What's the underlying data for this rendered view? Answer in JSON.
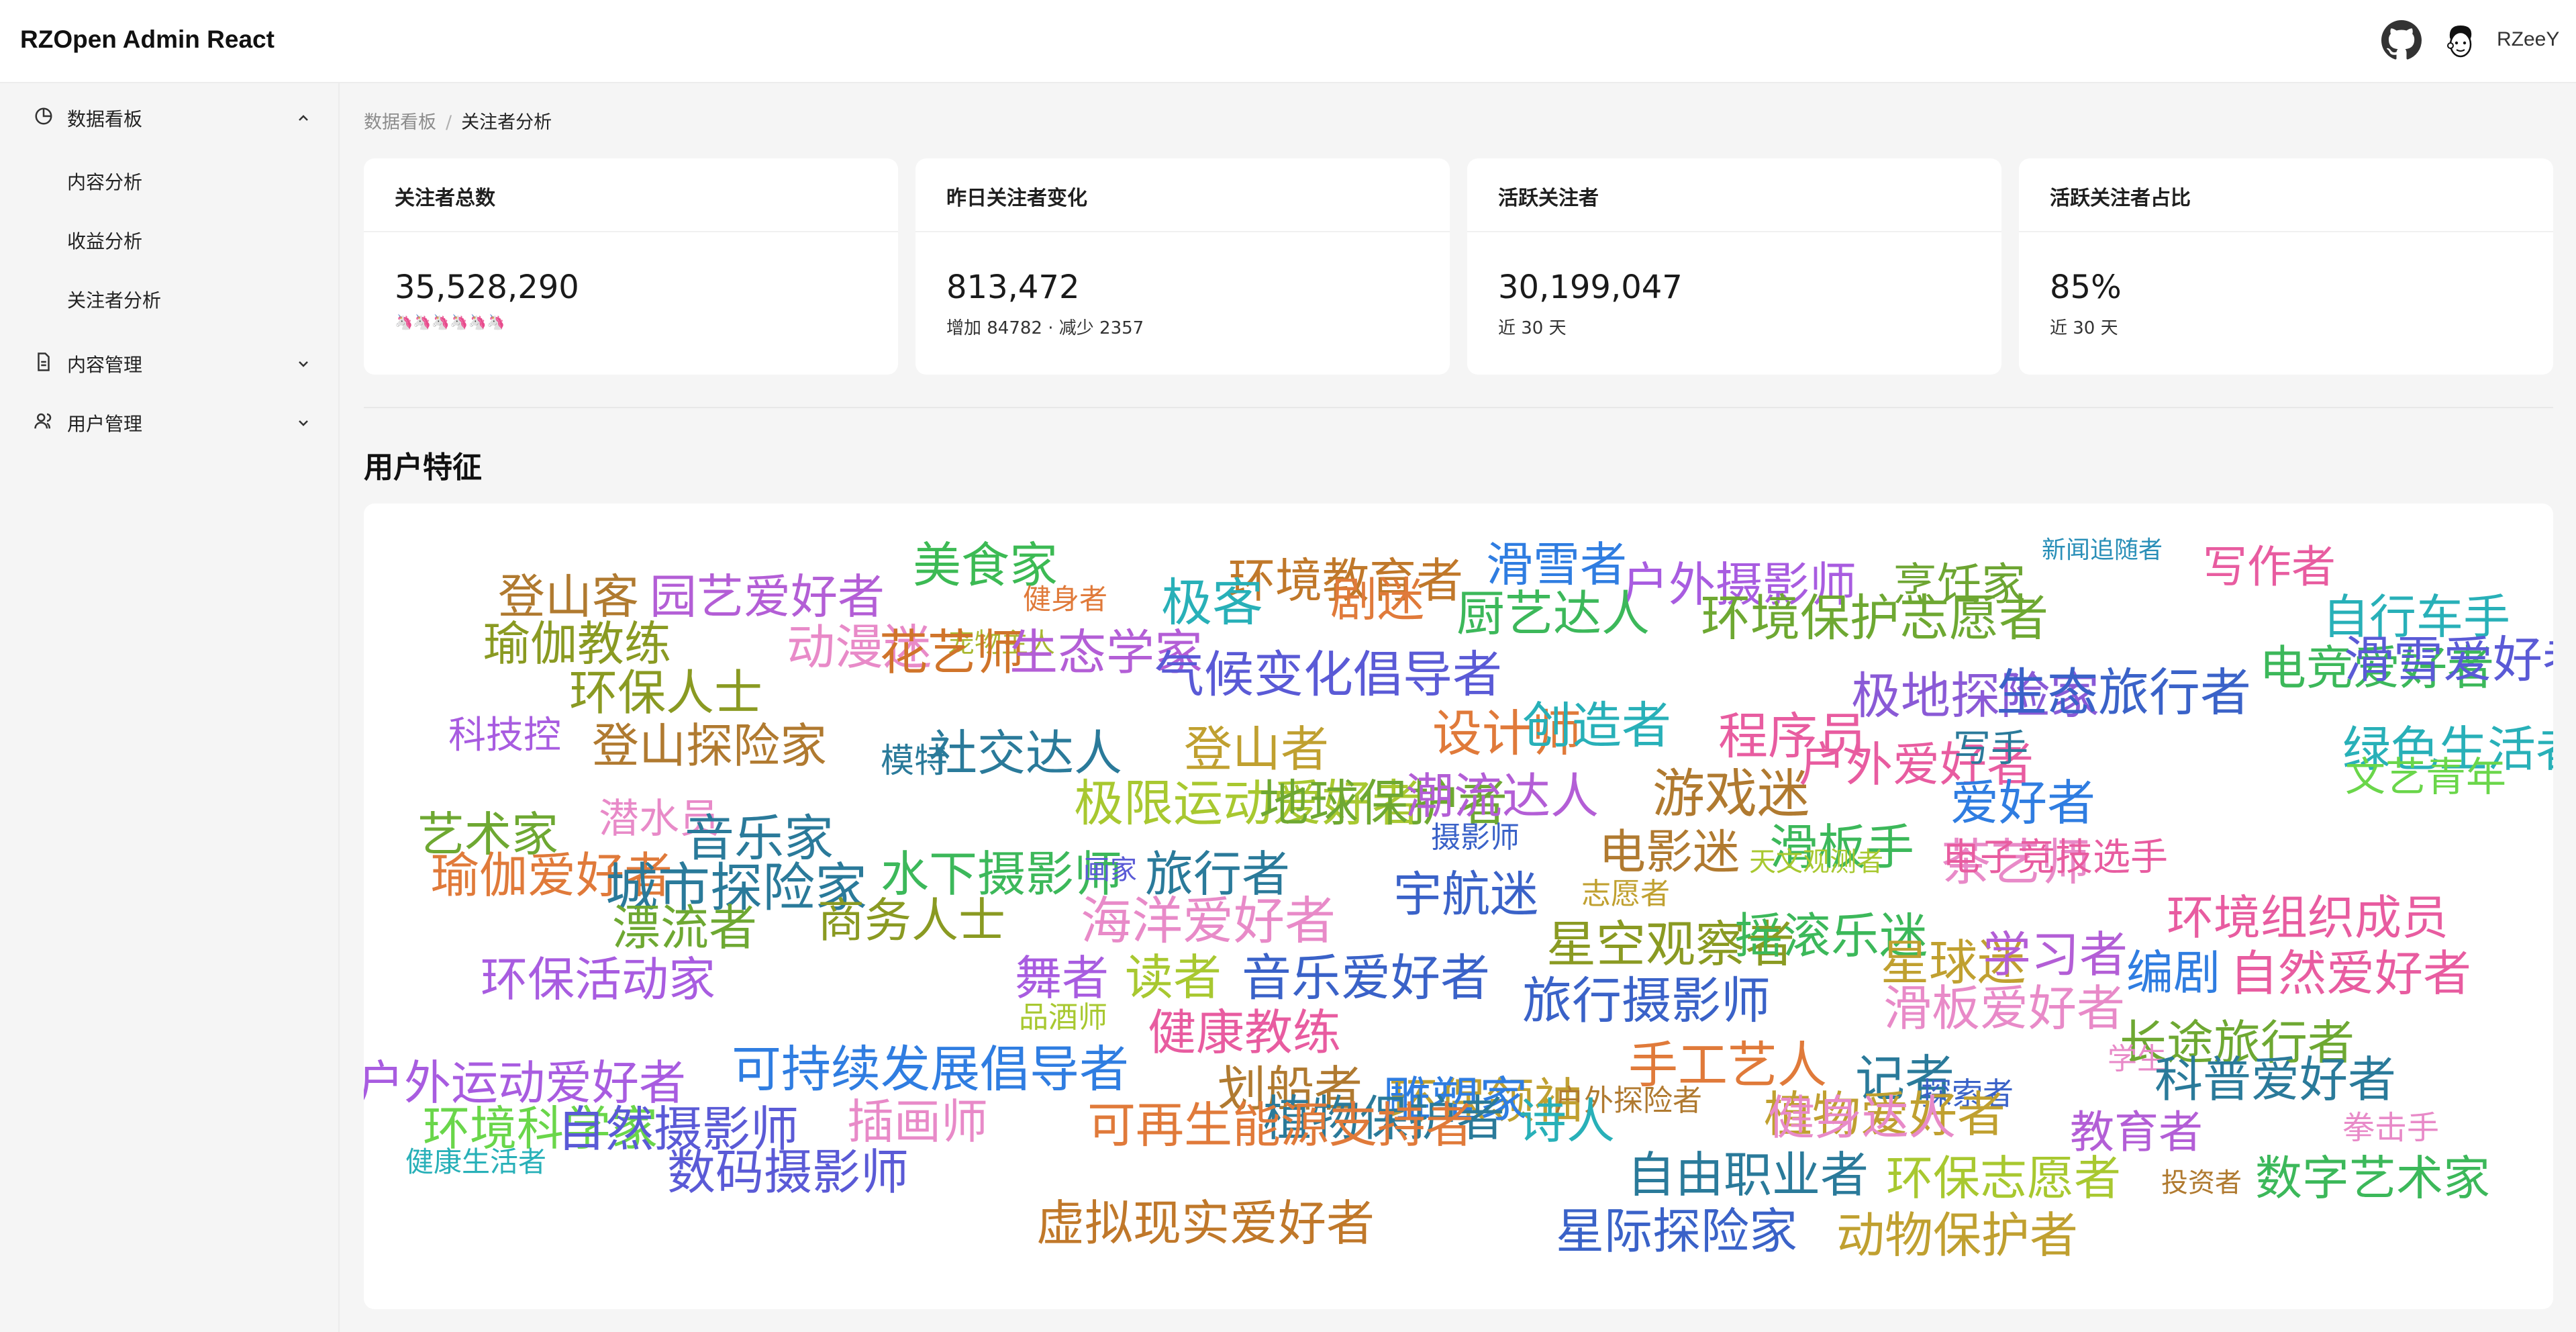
{
  "header": {
    "brand": "RZOpen Admin React",
    "icons": [
      "github-icon",
      "avatar"
    ],
    "username": "RZeeY"
  },
  "sidebar": {
    "items": [
      {
        "label": "数据看板",
        "icon": "dashboard-icon",
        "expanded": true,
        "children": [
          {
            "label": "内容分析"
          },
          {
            "label": "收益分析"
          },
          {
            "label": "关注者分析"
          }
        ]
      },
      {
        "label": "内容管理",
        "icon": "document-icon",
        "expanded": false
      },
      {
        "label": "用户管理",
        "icon": "users-icon",
        "expanded": false
      }
    ]
  },
  "breadcrumb": {
    "root": "数据看板",
    "separator": "/",
    "current": "关注者分析"
  },
  "stats": [
    {
      "title": "关注者总数",
      "value": "35,528,290",
      "sub": "🦄🦄🦄🦄🦄🦄"
    },
    {
      "title": "昨日关注者变化",
      "value": "813,472",
      "sub": "增加 84782 · 减少 2357"
    },
    {
      "title": "活跃关注者",
      "value": "30,199,047",
      "sub": "近 30 天"
    },
    {
      "title": "活跃关注者占比",
      "value": "85%",
      "sub": "近 30 天"
    }
  ],
  "section_title": "用户特征",
  "word_cloud": [
    {
      "t": "美食家",
      "c": "#3cba54"
    },
    {
      "t": "环境教育者",
      "c": "#c0782a"
    },
    {
      "t": "滑雪者",
      "c": "#2f7de1"
    },
    {
      "t": "户外摄影师",
      "c": "#a85ce0"
    },
    {
      "t": "烹饪家",
      "c": "#6da532"
    },
    {
      "t": "新闻追随者",
      "c": "#2a8fb8"
    },
    {
      "t": "写作者",
      "c": "#e85ca0"
    },
    {
      "t": "登山客",
      "c": "#b07a30"
    },
    {
      "t": "园艺爱好者",
      "c": "#b35ed6"
    },
    {
      "t": "健身者",
      "c": "#e07a3a"
    },
    {
      "t": "极客",
      "c": "#28b0b8"
    },
    {
      "t": "剧迷",
      "c": "#e07a3a"
    },
    {
      "t": "厨艺达人",
      "c": "#3cb85a"
    },
    {
      "t": "环境保护志愿者",
      "c": "#6ea832"
    },
    {
      "t": "自行车手",
      "c": "#28b0b8"
    },
    {
      "t": "瑜伽教练",
      "c": "#8a9a22"
    },
    {
      "t": "动漫迷",
      "c": "#e88ac8"
    },
    {
      "t": "宠物主人",
      "c": "#a8b830"
    },
    {
      "t": "花艺师",
      "c": "#d0742a"
    },
    {
      "t": "生态学家",
      "c": "#b35ed6"
    },
    {
      "t": "气候变化倡导者",
      "c": "#5a5ad6"
    },
    {
      "t": "极地探险家",
      "c": "#8a5ad6"
    },
    {
      "t": "生态旅行者",
      "c": "#3a62c8"
    },
    {
      "t": "电竞爱好者",
      "c": "#3cb85a"
    },
    {
      "t": "滑雪爱好者",
      "c": "#5a5ad6"
    },
    {
      "t": "环保人士",
      "c": "#8a9a22"
    },
    {
      "t": "科技控",
      "c": "#a85ce0"
    },
    {
      "t": "登山探险家",
      "c": "#b07a30"
    },
    {
      "t": "模特",
      "c": "#2a7a9a"
    },
    {
      "t": "社交达人",
      "c": "#2a7a9a"
    },
    {
      "t": "登山者",
      "c": "#c0a030"
    },
    {
      "t": "设计师",
      "c": "#e07a3a"
    },
    {
      "t": "创造者",
      "c": "#28b0b8"
    },
    {
      "t": "程序员",
      "c": "#e85ca0"
    },
    {
      "t": "绿色生活者",
      "c": "#28b0b8"
    },
    {
      "t": "户外爱好者",
      "c": "#e85ca0"
    },
    {
      "t": "写手",
      "c": "#2a7a9a"
    },
    {
      "t": "文艺青年",
      "c": "#6ad64a"
    },
    {
      "t": "艺术家",
      "c": "#6ea832"
    },
    {
      "t": "潜水员",
      "c": "#e88ac8"
    },
    {
      "t": "音乐家",
      "c": "#2a7a9a"
    },
    {
      "t": "极限运动爱好者",
      "c": "#a8c830"
    },
    {
      "t": "地球保护者",
      "c": "#6ea832"
    },
    {
      "t": "潮流达人",
      "c": "#b35ed6"
    },
    {
      "t": "游戏迷",
      "c": "#b07a30"
    },
    {
      "t": "爱好者",
      "c": "#2f7de1"
    },
    {
      "t": "摄影师",
      "c": "#3a62c8"
    },
    {
      "t": "电影迷",
      "c": "#b07a30"
    },
    {
      "t": "滑板手",
      "c": "#3cb85a"
    },
    {
      "t": "天文观测者",
      "c": "#a8c830"
    },
    {
      "t": "茶艺师",
      "c": "#e88ac8"
    },
    {
      "t": "瑜伽爱好者",
      "c": "#e07a3a"
    },
    {
      "t": "城市探险家",
      "c": "#2a7a9a"
    },
    {
      "t": "水下摄影师",
      "c": "#3cb85a"
    },
    {
      "t": "画家",
      "c": "#5a5ad6"
    },
    {
      "t": "旅行者",
      "c": "#2a7a9a"
    },
    {
      "t": "宇航迷",
      "c": "#3a62c8"
    },
    {
      "t": "志愿者",
      "c": "#c0a030"
    },
    {
      "t": "电子竞技选手",
      "c": "#e85ca0"
    },
    {
      "t": "漂流者",
      "c": "#6ea832"
    },
    {
      "t": "商务人士",
      "c": "#8a9a22"
    },
    {
      "t": "海洋爱好者",
      "c": "#e88ac8"
    },
    {
      "t": "星空观察者",
      "c": "#8a9a22"
    },
    {
      "t": "摇滚乐迷",
      "c": "#3cb85a"
    },
    {
      "t": "星球迷",
      "c": "#c0a030"
    },
    {
      "t": "学习者",
      "c": "#b35ed6"
    },
    {
      "t": "环境组织成员",
      "c": "#e85ca0"
    },
    {
      "t": "编剧",
      "c": "#2f7de1"
    },
    {
      "t": "自然爱好者",
      "c": "#e85ca0"
    },
    {
      "t": "环保活动家",
      "c": "#a85ce0"
    },
    {
      "t": "舞者",
      "c": "#a85ce0"
    },
    {
      "t": "读者",
      "c": "#a8c830"
    },
    {
      "t": "音乐爱好者",
      "c": "#3a62c8"
    },
    {
      "t": "旅行摄影师",
      "c": "#3a62c8"
    },
    {
      "t": "滑板爱好者",
      "c": "#e88ac8"
    },
    {
      "t": "品酒师",
      "c": "#a8c830"
    },
    {
      "t": "健康教练",
      "c": "#e85ca0"
    },
    {
      "t": "长途旅行者",
      "c": "#6ea832"
    },
    {
      "t": "户外运动爱好者",
      "c": "#a85ce0"
    },
    {
      "t": "可持续发展倡导者",
      "c": "#2f7de1"
    },
    {
      "t": "划船者",
      "c": "#b07a30"
    },
    {
      "t": "手工艺人",
      "c": "#e07a3a"
    },
    {
      "t": "记者",
      "c": "#2a7a9a"
    },
    {
      "t": "探索者",
      "c": "#3a62c8"
    },
    {
      "t": "学生",
      "c": "#e88ac8"
    },
    {
      "t": "科普爱好者",
      "c": "#2a7a9a"
    },
    {
      "t": "环境科学家",
      "c": "#6ad64a"
    },
    {
      "t": "自然摄影师",
      "c": "#5a5ad6"
    },
    {
      "t": "插画师",
      "c": "#e88ac8"
    },
    {
      "t": "环保领袖",
      "c": "#c0a030"
    },
    {
      "t": "雕塑家",
      "c": "#2f7de1"
    },
    {
      "t": "户外探险者",
      "c": "#b07a30"
    },
    {
      "t": "植物保护者",
      "c": "#2a7a9a"
    },
    {
      "t": "诗人",
      "c": "#28b0b8"
    },
    {
      "t": "植物爱好者",
      "c": "#c0a030"
    },
    {
      "t": "健身达人",
      "c": "#e88ac8"
    },
    {
      "t": "教育者",
      "c": "#b35ed6"
    },
    {
      "t": "拳击手",
      "c": "#e88ac8"
    },
    {
      "t": "健康生活者",
      "c": "#28b0b8"
    },
    {
      "t": "数码摄影师",
      "c": "#5a5ad6"
    },
    {
      "t": "可再生能源支持者",
      "c": "#e07a3a"
    },
    {
      "t": "自由职业者",
      "c": "#2a7a9a"
    },
    {
      "t": "环保志愿者",
      "c": "#a8c830"
    },
    {
      "t": "投资者",
      "c": "#b07a30"
    },
    {
      "t": "数字艺术家",
      "c": "#3cb85a"
    },
    {
      "t": "虚拟现实爱好者",
      "c": "#c0782a"
    },
    {
      "t": "星际探险家",
      "c": "#3a62c8"
    },
    {
      "t": "动物保护者",
      "c": "#c0a030"
    }
  ]
}
